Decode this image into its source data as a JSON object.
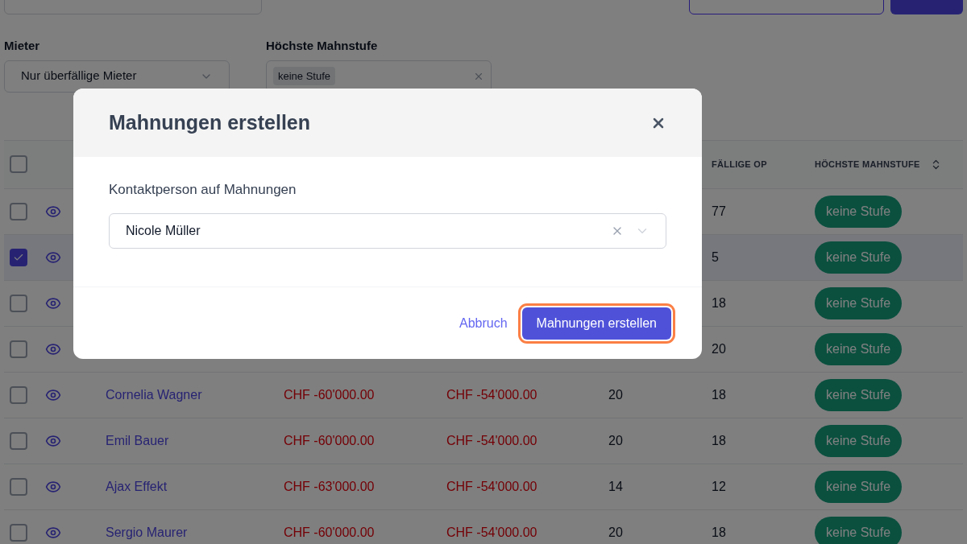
{
  "filters": [
    {
      "label": "Mieter",
      "value": "Nur überfällige Mieter"
    },
    {
      "label": "Höchste Mahnstufe",
      "chips": [
        "keine Stufe"
      ]
    }
  ],
  "table": {
    "all_checked": false,
    "columns": [
      {
        "label": "FÄLLIGE OP",
        "sortable": false
      },
      {
        "label": "HÖCHSTE MAHNSTUFE",
        "sortable": true
      }
    ],
    "rows": [
      {
        "checked": false,
        "faellige_op": "77",
        "mahnstufe": "keine Stufe"
      },
      {
        "checked": true,
        "faellige_op": "5",
        "mahnstufe": "keine Stufe"
      },
      {
        "checked": false,
        "faellige_op": "18",
        "mahnstufe": "keine Stufe"
      },
      {
        "checked": false,
        "faellige_op": "20",
        "mahnstufe": "keine Stufe"
      },
      {
        "checked": false,
        "name": "Cornelia Wagner",
        "amount_1": "CHF -60'000.00",
        "amount_2": "CHF -54'000.00",
        "column_4": "20",
        "faellige_op": "18",
        "mahnstufe": "keine Stufe"
      },
      {
        "checked": false,
        "name": "Emil Bauer",
        "amount_1": "CHF -60'000.00",
        "amount_2": "CHF -54'000.00",
        "column_4": "20",
        "faellige_op": "18",
        "mahnstufe": "keine Stufe"
      },
      {
        "checked": false,
        "name": "Ajax Effekt",
        "amount_1": "CHF -63'000.00",
        "amount_2": "CHF -54'000.00",
        "column_4": "14",
        "faellige_op": "12",
        "mahnstufe": "keine Stufe"
      },
      {
        "checked": false,
        "name": "Sergio Maurer",
        "amount_1": "CHF -60'000.00",
        "amount_2": "CHF -54'000.00",
        "column_4": "20",
        "faellige_op": "18",
        "mahnstufe": "keine Stufe"
      }
    ]
  },
  "dialog": {
    "title": "Mahnungen erstellen",
    "field_label": "Kontaktperson auf Mahnungen",
    "field_value": "Nicole Müller",
    "cancel": "Abbruch",
    "submit": "Mahnungen erstellen",
    "submit_focused": true
  }
}
